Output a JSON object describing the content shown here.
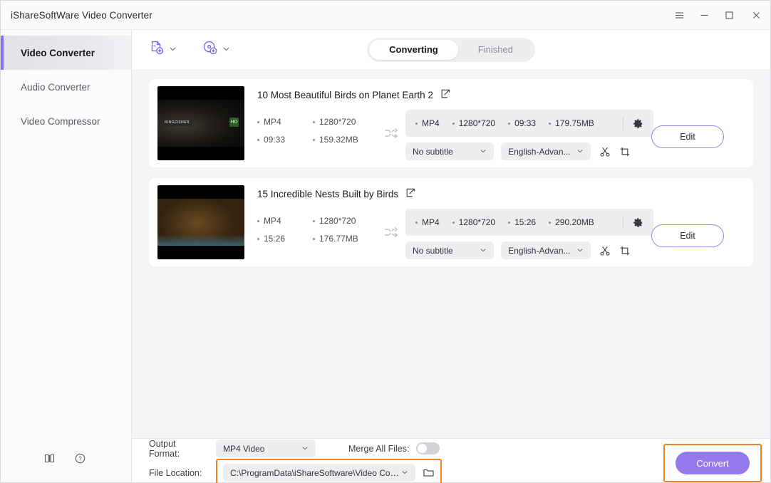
{
  "window": {
    "title": "iShareSoftWare Video Converter",
    "controls": [
      {
        "name": "menu-icon",
        "label": "Menu"
      },
      {
        "name": "minimize-icon",
        "label": "Minimize"
      },
      {
        "name": "maximize-icon",
        "label": "Maximize"
      },
      {
        "name": "close-icon",
        "label": "Close"
      }
    ]
  },
  "sidebar": {
    "items": [
      {
        "label": "Video Converter",
        "active": true
      },
      {
        "label": "Audio Converter",
        "active": false
      },
      {
        "label": "Video Compressor",
        "active": false
      }
    ],
    "footer": [
      {
        "name": "manual-icon",
        "label": "User Guide"
      },
      {
        "name": "help-icon",
        "label": "Help"
      }
    ]
  },
  "toolbar": {
    "add_file": {
      "icon": "add-file-icon",
      "label": "Add Files"
    },
    "add_disc": {
      "icon": "add-disc-icon",
      "label": "Load Disc"
    },
    "tabs": [
      {
        "label": "Converting",
        "active": true
      },
      {
        "label": "Finished",
        "active": false
      }
    ]
  },
  "files": [
    {
      "title": "10 Most Beautiful Birds on Planet Earth 2",
      "thumbnail_label": "KINGFISHER",
      "thumbnail_badge": "HD",
      "source": {
        "format": "MP4",
        "resolution": "1280*720",
        "duration": "09:33",
        "size": "159.32MB"
      },
      "output": {
        "format": "MP4",
        "resolution": "1280*720",
        "duration": "09:33",
        "size": "179.75MB"
      },
      "subtitle": "No subtitle",
      "audio": "English-Advan...",
      "edit_label": "Edit"
    },
    {
      "title": "15 Incredible Nests Built by Birds",
      "thumbnail_label": "",
      "thumbnail_badge": "",
      "source": {
        "format": "MP4",
        "resolution": "1280*720",
        "duration": "15:26",
        "size": "176.77MB"
      },
      "output": {
        "format": "MP4",
        "resolution": "1280*720",
        "duration": "15:26",
        "size": "290.20MB"
      },
      "subtitle": "No subtitle",
      "audio": "English-Advan...",
      "edit_label": "Edit"
    }
  ],
  "bottom": {
    "output_format_label": "Output Format:",
    "output_format_value": "MP4 Video",
    "merge_label": "Merge All Files:",
    "merge_enabled": false,
    "file_location_label": "File Location:",
    "file_location_value": "C:\\ProgramData\\iShareSoftware\\Video Conve",
    "convert_label": "Convert"
  },
  "colors": {
    "accent_purple": "#8b6ff0",
    "convert_button": "#9479ec",
    "highlight_orange": "#ef8327",
    "content_background": "#f4f4f6"
  }
}
